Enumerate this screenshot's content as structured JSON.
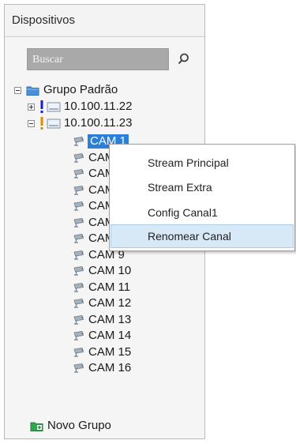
{
  "panel": {
    "title": "Dispositivos",
    "search_placeholder": "Buscar"
  },
  "tree": {
    "group_label": "Grupo Padrão",
    "devices": [
      {
        "label": "10.100.11.22",
        "expanded": false,
        "status_color": "#1a1adc"
      },
      {
        "label": "10.100.11.23",
        "expanded": true,
        "status_color": "#e08a00"
      }
    ],
    "cameras": [
      {
        "label": "CAM 1",
        "selected": true
      },
      {
        "label": "CAM 2"
      },
      {
        "label": "CAM 3"
      },
      {
        "label": "CAM 4"
      },
      {
        "label": "CAM 5"
      },
      {
        "label": "CAM 7"
      },
      {
        "label": "CAM 8"
      },
      {
        "label": "CAM 9"
      },
      {
        "label": "CAM 10"
      },
      {
        "label": "CAM 11"
      },
      {
        "label": "CAM 12"
      },
      {
        "label": "CAM 13"
      },
      {
        "label": "CAM 14"
      },
      {
        "label": "CAM 15"
      },
      {
        "label": "CAM 16"
      }
    ],
    "new_group_label": "Novo Grupo"
  },
  "context_menu": {
    "items": [
      "Stream Principal",
      "Stream Extra",
      "Config Canal1",
      "Renomear Canal"
    ],
    "highlighted": "Renomear Canal"
  },
  "colors": {
    "selection": "#2b7fd8",
    "menu_hover": "#d7e8f7",
    "folder": "#4a90d9",
    "new_group": "#2fa84f"
  }
}
